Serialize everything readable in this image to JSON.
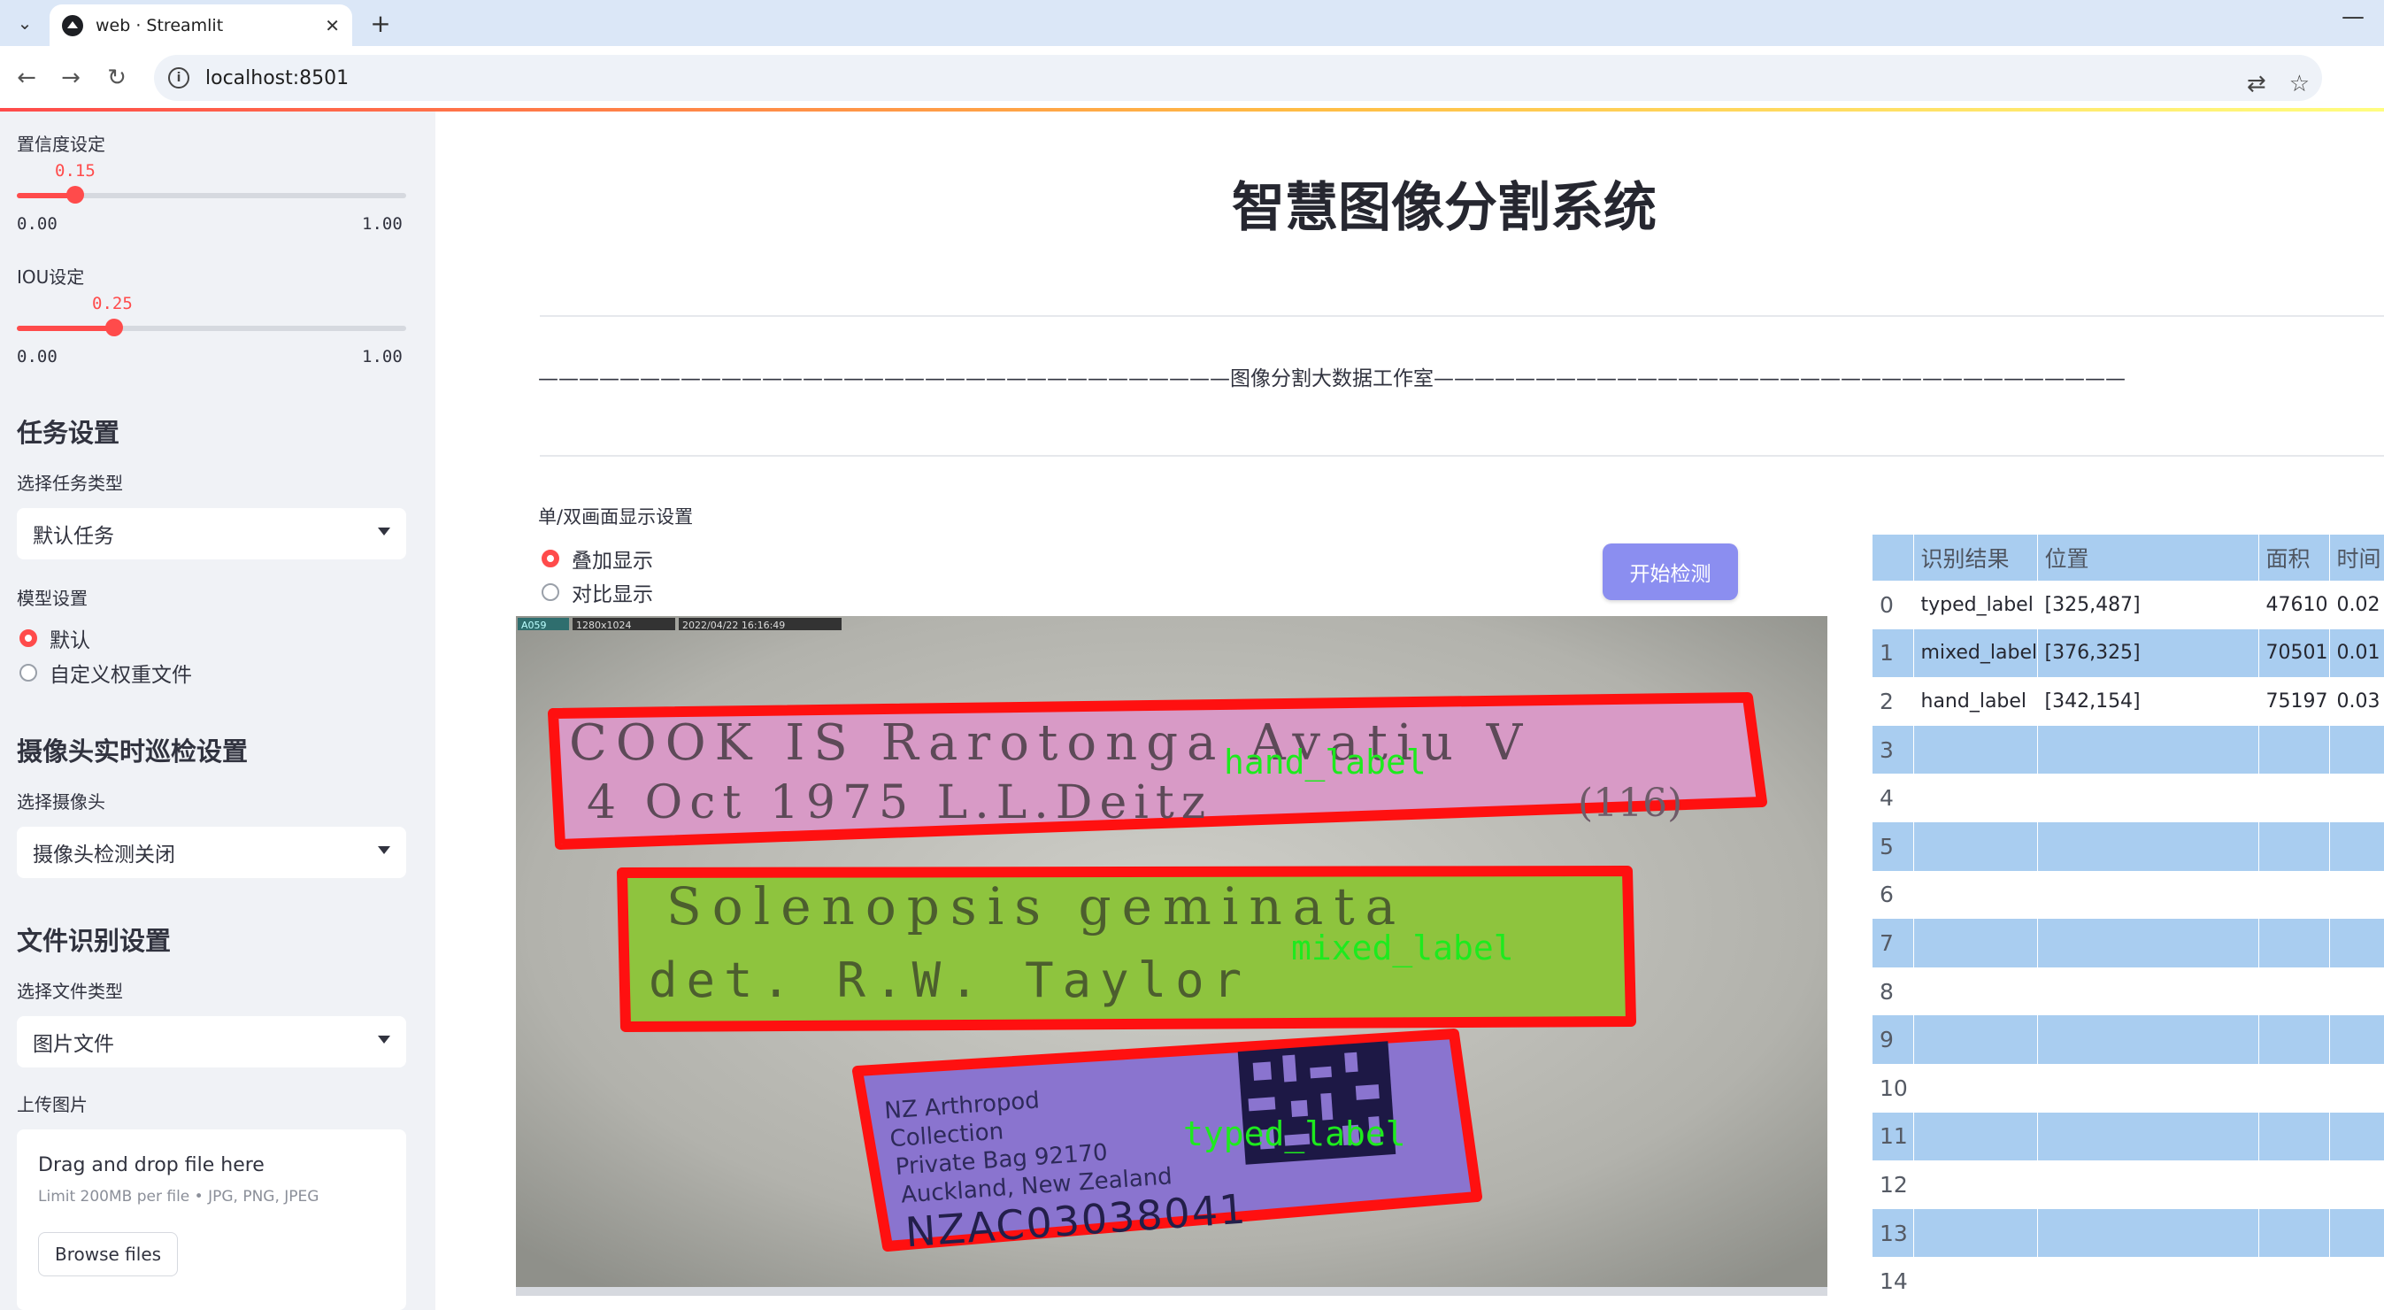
{
  "browser": {
    "tab_title": "web · Streamlit",
    "url": "localhost:8501"
  },
  "sidebar": {
    "confidence": {
      "label": "置信度设定",
      "value": "0.15",
      "min": "0.00",
      "max": "1.00",
      "fraction": 0.15
    },
    "iou": {
      "label": "IOU设定",
      "value": "0.25",
      "min": "0.00",
      "max": "1.00",
      "fraction": 0.25
    },
    "task_section": {
      "title": "任务设置",
      "label": "选择任务类型",
      "selected": "默认任务"
    },
    "model": {
      "label": "模型设置",
      "options": [
        "默认",
        "自定义权重文件"
      ],
      "selected_index": 0
    },
    "camera_section": {
      "title": "摄像头实时巡检设置",
      "label": "选择摄像头",
      "selected": "摄像头检测关闭"
    },
    "file_section": {
      "title": "文件识别设置",
      "label": "选择文件类型",
      "selected": "图片文件"
    },
    "upload": {
      "label": "上传图片",
      "drop_text": "Drag and drop file here",
      "limit_text": "Limit 200MB per file • JPG, PNG, JPEG",
      "button": "Browse files"
    }
  },
  "main": {
    "title": "智慧图像分割系统",
    "studio": "——————————————————————————————————图像分割大数据工作室——————————————————————————————————",
    "display_mode": {
      "label": "单/双画面显示设置",
      "options": [
        "叠加显示",
        "对比显示"
      ],
      "selected_index": 0
    },
    "start_button": "开始检测",
    "image": {
      "header_tag": "A059",
      "header_res": "1280x1024",
      "header_time": "2022/04/22 16:16:49",
      "label1_line1": "COOK IS Rarotonga Avatiu V",
      "label1_line2": "4 Oct 1975 L.L.Deitz",
      "label1_num": "(116)",
      "label2_line1": "Solenopsis geminata",
      "label2_line2": "det. R.W. Taylor",
      "label3_line1": "NZ Arthropod",
      "label3_line2": "Collection",
      "label3_line3": "Private Bag 92170",
      "label3_line4": "Auckland, New Zealand",
      "label3_code": "NZAC03038041",
      "det_hand": "hand_label",
      "det_mixed": "mixed_label",
      "det_typed": "typed_label"
    }
  },
  "results": {
    "columns": [
      "",
      "识别结果",
      "位置",
      "面积",
      "时间"
    ],
    "rows": [
      {
        "idx": "0",
        "label": "typed_label",
        "pos": "[325,487]",
        "area": "47610",
        "time": "0.02"
      },
      {
        "idx": "1",
        "label": "mixed_label",
        "pos": "[376,325]",
        "area": "70501",
        "time": "0.01"
      },
      {
        "idx": "2",
        "label": "hand_label",
        "pos": "[342,154]",
        "area": "75197",
        "time": "0.03"
      },
      {
        "idx": "3",
        "label": "",
        "pos": "",
        "area": "",
        "time": ""
      },
      {
        "idx": "4",
        "label": "",
        "pos": "",
        "area": "",
        "time": ""
      },
      {
        "idx": "5",
        "label": "",
        "pos": "",
        "area": "",
        "time": ""
      },
      {
        "idx": "6",
        "label": "",
        "pos": "",
        "area": "",
        "time": ""
      },
      {
        "idx": "7",
        "label": "",
        "pos": "",
        "area": "",
        "time": ""
      },
      {
        "idx": "8",
        "label": "",
        "pos": "",
        "area": "",
        "time": ""
      },
      {
        "idx": "9",
        "label": "",
        "pos": "",
        "area": "",
        "time": ""
      },
      {
        "idx": "10",
        "label": "",
        "pos": "",
        "area": "",
        "time": ""
      },
      {
        "idx": "11",
        "label": "",
        "pos": "",
        "area": "",
        "time": ""
      },
      {
        "idx": "12",
        "label": "",
        "pos": "",
        "area": "",
        "time": ""
      },
      {
        "idx": "13",
        "label": "",
        "pos": "",
        "area": "",
        "time": ""
      },
      {
        "idx": "14",
        "label": "",
        "pos": "",
        "area": "",
        "time": ""
      }
    ]
  }
}
